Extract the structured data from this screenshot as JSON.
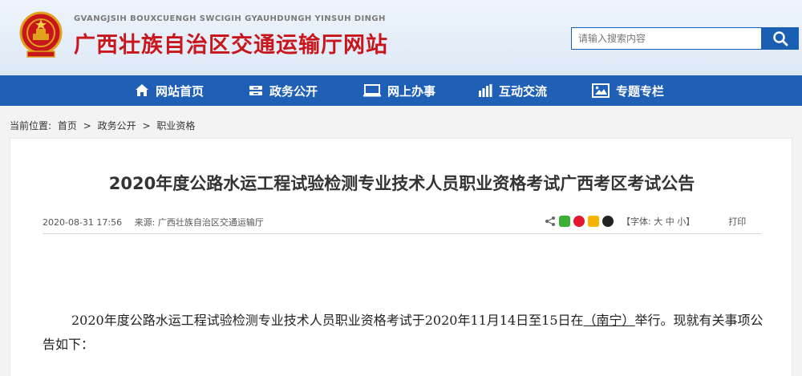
{
  "header": {
    "pinyin": "GVANGJSIH BOUXCUENGH SWCIGIH GYAUHDUNGH YINSUH DINGH",
    "title": "广西壮族自治区交通运输厅网站",
    "search": {
      "placeholder": "请输入搜索内容"
    },
    "colors": {
      "title": "#c8161d",
      "accent": "#1f60b6"
    }
  },
  "nav": {
    "items": [
      {
        "label": "网站首页",
        "icon": "home-icon"
      },
      {
        "label": "政务公开",
        "icon": "inbox-icon"
      },
      {
        "label": "网上办事",
        "icon": "monitor-icon"
      },
      {
        "label": "互动交流",
        "icon": "bar-chart-icon"
      },
      {
        "label": "专题专栏",
        "icon": "image-icon"
      }
    ]
  },
  "breadcrumb": {
    "prefix": "当前位置:",
    "items": [
      "首页",
      "政务公开",
      "职业资格"
    ],
    "separator": ">"
  },
  "article": {
    "title": "2020年度公路水运工程试验检测专业技术人员职业资格考试广西考区考试公告",
    "date": "2020-08-31 17:56",
    "source": "来源: 广西壮族自治区交通运输厅",
    "font_size_label": "【字体: 大 中 小】",
    "print_label": "打印",
    "para_before": "2020年度公路水运工程试验检测专业技术人员职业资格考试于2020年11月14日至15日在",
    "para_city": "（南宁）",
    "para_after": "举行。现就有关事项公告如下："
  }
}
